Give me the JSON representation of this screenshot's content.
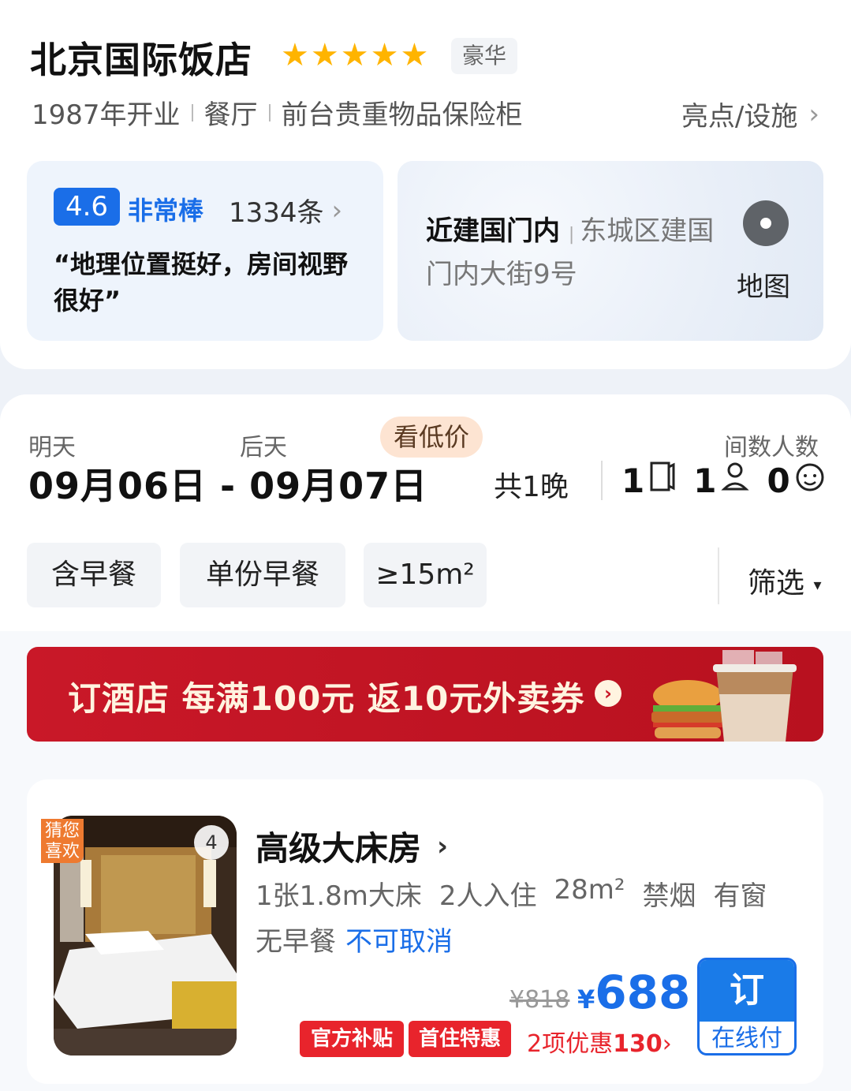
{
  "hotel": {
    "name": "北京国际饭店",
    "star_count": 5,
    "tier": "豪华",
    "facilities": [
      "1987年开业",
      "餐厅",
      "前台贵重物品保险柜"
    ],
    "highlights_link": "亮点/设施"
  },
  "review": {
    "score": "4.6",
    "label": "非常棒",
    "count": "1334条",
    "quote": "“地理位置挺好，房间视野很好”"
  },
  "location": {
    "area": "近建国门内",
    "address": "东城区建国门内大街9号",
    "map_label": "地图"
  },
  "stay": {
    "checkin_label": "明天",
    "checkout_label": "后天",
    "dates": "09月06日 - 09月07日",
    "low_price_tag": "看低价",
    "nights": "共1晚",
    "rooms_guests_label": "间数人数",
    "rooms": "1",
    "adults": "1",
    "children": "0"
  },
  "filters": {
    "chips": [
      "含早餐",
      "单份早餐",
      "≥15m²"
    ],
    "filter_label": "筛选"
  },
  "banner": {
    "text": "订酒店 每满100元 返10元外卖券"
  },
  "room": {
    "guess_tag": "猜您喜欢",
    "photo_count": "4",
    "name": "高级大床房",
    "attrs": [
      "1张1.8m大床",
      "2人入住",
      "28m²",
      "禁烟",
      "有窗"
    ],
    "meal": "无早餐",
    "cancel": "不可取消",
    "original_price": "¥818",
    "currency": "¥",
    "price": "688",
    "promos": [
      "官方补贴",
      "首住特惠"
    ],
    "discount_prefix": "2项优惠",
    "discount_amount": "130",
    "book_label": "订",
    "pay_label": "在线付"
  },
  "colors": {
    "accent_blue": "#1a6ee8",
    "star_gold": "#ffb400",
    "promo_red": "#e8242c",
    "banner_red": "#c91828"
  }
}
